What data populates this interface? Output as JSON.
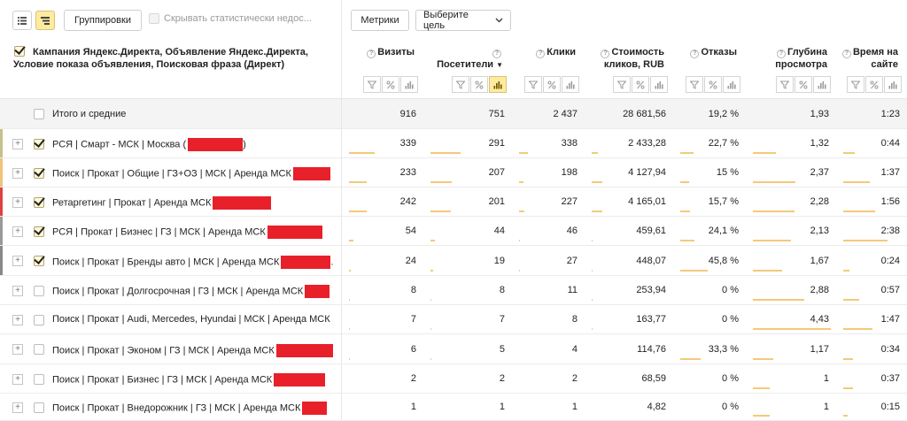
{
  "toolbar": {
    "groupings_label": "Группировки",
    "hide_stat_label": "Скрывать статистически недос...",
    "metrics_label": "Метрики",
    "goal_label": "Выберите цель"
  },
  "header": {
    "dimension_title": "Кампания Яндекс.Директа, Объявление Яндекс.Директа, Условие показа объявления, Поисковая фраза (Директ)",
    "columns": [
      {
        "label": "Визиты"
      },
      {
        "label": "Посетители"
      },
      {
        "label": "Клики"
      },
      {
        "label": "Стоимость кликов, RUB"
      },
      {
        "label": "Отказы"
      },
      {
        "label": "Глубина просмотра"
      },
      {
        "label": "Время на сайте"
      }
    ],
    "sort_arrow": "▼",
    "ctrl_icons": {
      "filter": "filter-icon",
      "percent": "percent-icon",
      "bars": "bar-chart-icon"
    }
  },
  "total": {
    "label": "Итого и средние",
    "values": [
      "916",
      "751",
      "2 437",
      "28 681,56",
      "19,2 %",
      "1,93",
      "1:23"
    ]
  },
  "rows": [
    {
      "label": "РСЯ | Смарт - МСК | Москва (",
      "suffix": ")",
      "checked": true,
      "strip": "#c6c08a",
      "values": [
        "339",
        "291",
        "338",
        "2 433,28",
        "22,7 %",
        "1,32",
        "0:44"
      ],
      "bars": [
        0.37,
        0.39,
        0.14,
        0.085,
        0.227,
        0.3,
        0.2
      ]
    },
    {
      "label": "Поиск | Прокат | Общие | ГЗ+ОЗ | МСК | Аренда МСК",
      "suffix": "",
      "checked": true,
      "strip": "#f0c27a",
      "values": [
        "233",
        "207",
        "198",
        "4 127,94",
        "15 %",
        "2,37",
        "1:37"
      ],
      "bars": [
        0.25,
        0.28,
        0.08,
        0.144,
        0.15,
        0.55,
        0.45
      ]
    },
    {
      "label": "Ретаргетинг | Прокат | Аренда МСК",
      "suffix": "",
      "checked": true,
      "strip": "#e04040",
      "values": [
        "242",
        "201",
        "227",
        "4 165,01",
        "15,7 %",
        "2,28",
        "1:56"
      ],
      "bars": [
        0.26,
        0.27,
        0.09,
        0.145,
        0.157,
        0.53,
        0.55
      ]
    },
    {
      "label": "РСЯ | Прокат | Бизнес | ГЗ | МСК | Аренда МСК",
      "suffix": "",
      "checked": true,
      "strip": "#999999",
      "values": [
        "54",
        "44",
        "46",
        "459,61",
        "24,1 %",
        "2,13",
        "2:38"
      ],
      "bars": [
        0.06,
        0.06,
        0.02,
        0.016,
        0.241,
        0.49,
        0.75
      ]
    },
    {
      "label": "Поиск | Прокат | Бренды авто | МСК | Аренда МСК",
      "suffix": ".",
      "checked": true,
      "strip": "#888888",
      "values": [
        "24",
        "19",
        "27",
        "448,07",
        "45,8 %",
        "1,67",
        "0:24"
      ],
      "bars": [
        0.03,
        0.03,
        0.01,
        0.016,
        0.458,
        0.38,
        0.11
      ]
    },
    {
      "label": "Поиск | Прокат | Долгосрочная | ГЗ | МСК | Аренда МСК",
      "suffix": "",
      "checked": false,
      "strip": "",
      "values": [
        "8",
        "8",
        "11",
        "253,94",
        "0 %",
        "2,88",
        "0:57"
      ],
      "bars": [
        0.01,
        0.01,
        0.0,
        0.009,
        0.0,
        0.66,
        0.27
      ]
    },
    {
      "label": "Поиск | Прокат | Audi, Mercedes, Hyundai | МСК | Аренда МСК",
      "suffix": "",
      "checked": false,
      "strip": "",
      "values": [
        "7",
        "7",
        "8",
        "163,77",
        "0 %",
        "4,43",
        "1:47"
      ],
      "bars": [
        0.01,
        0.01,
        0.0,
        0.006,
        0.0,
        1.0,
        0.5
      ]
    },
    {
      "label": "Поиск | Прокат | Эконом | ГЗ | МСК | Аренда МСК",
      "suffix": "",
      "checked": false,
      "strip": "",
      "values": [
        "6",
        "5",
        "4",
        "114,76",
        "33,3 %",
        "1,17",
        "0:34"
      ],
      "bars": [
        0.01,
        0.01,
        0.0,
        0.004,
        0.333,
        0.26,
        0.16
      ]
    },
    {
      "label": "Поиск | Прокат | Бизнес | ГЗ | МСК | Аренда МСК",
      "suffix": "",
      "checked": false,
      "strip": "",
      "values": [
        "2",
        "2",
        "2",
        "68,59",
        "0 %",
        "1",
        "0:37"
      ],
      "bars": [
        0.0,
        0.0,
        0.0,
        0.002,
        0.0,
        0.22,
        0.17
      ]
    },
    {
      "label": "Поиск | Прокат | Внедорожник | ГЗ | МСК | Аренда МСК",
      "suffix": "",
      "checked": false,
      "strip": "",
      "values": [
        "1",
        "1",
        "1",
        "4,82",
        "0 %",
        "1",
        "0:15"
      ],
      "bars": [
        0.0,
        0.0,
        0.0,
        0.0,
        0.0,
        0.22,
        0.07
      ]
    }
  ]
}
